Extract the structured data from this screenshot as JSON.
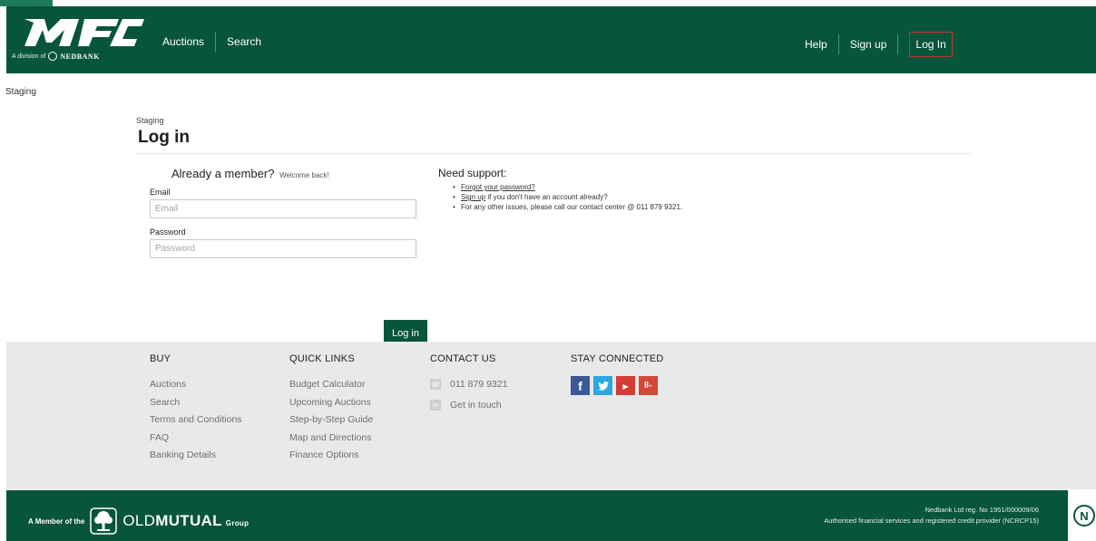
{
  "brand": {
    "logo_text": "MFC",
    "division_prefix": "A division of",
    "division_name": "NEDBANK"
  },
  "header_nav": {
    "auctions": "Auctions",
    "search": "Search",
    "help": "Help",
    "sign_up": "Sign up",
    "log_in": "Log In"
  },
  "environment_label": "Staging",
  "login": {
    "breadcrumb": "Staging",
    "title": "Log in",
    "member_heading": "Already a member?",
    "welcome_text": "Welcome back!",
    "email_label": "Email",
    "email_placeholder": "Email",
    "email_value": "",
    "password_label": "Password",
    "password_placeholder": "Password",
    "password_value": "",
    "submit_label": "Log in"
  },
  "support": {
    "heading": "Need support:",
    "forgot_link": "Forgot your password?",
    "signup_link": "Sign up",
    "signup_suffix": " if you don't have an account already?",
    "contact_text": "For any other issues, please call our contact center @ 011 879 9321."
  },
  "footer": {
    "buy": {
      "heading": "BUY",
      "links": [
        "Auctions",
        "Search",
        "Terms and Conditions",
        "FAQ",
        "Banking Details"
      ]
    },
    "quick_links": {
      "heading": "QUICK LINKS",
      "links": [
        "Budget Calculator",
        "Upcoming Auctions",
        "Step-by-Step Guide",
        "Map and Directions",
        "Finance Options"
      ]
    },
    "contact_us": {
      "heading": "CONTACT US",
      "phone": "011 879 9321",
      "get_in_touch": "Get in touch"
    },
    "stay_connected": {
      "heading": "STAY CONNECTED",
      "networks": [
        {
          "name": "facebook-icon",
          "glyph": "f",
          "color": "#3b5998"
        },
        {
          "name": "twitter-icon",
          "glyph": "t",
          "color": "#2ca7e0"
        },
        {
          "name": "youtube-icon",
          "glyph": "You",
          "color": "#d23f37"
        },
        {
          "name": "google-plus-icon",
          "glyph": "g+",
          "color": "#d34836"
        }
      ]
    }
  },
  "bottom_bar": {
    "member_prefix": "A Member of the",
    "om_light": "OLD",
    "om_bold": "MUTUAL",
    "om_group": "Group",
    "reg_line1": "Nedbank Ltd reg. No 1951/000009/06",
    "reg_line2": "Authorised financial services and registered credit provider (NCRCP15)"
  },
  "colors": {
    "brand_green": "#07553b",
    "login_highlight": "#c0362c",
    "footer_bg": "#e9e9e9"
  }
}
